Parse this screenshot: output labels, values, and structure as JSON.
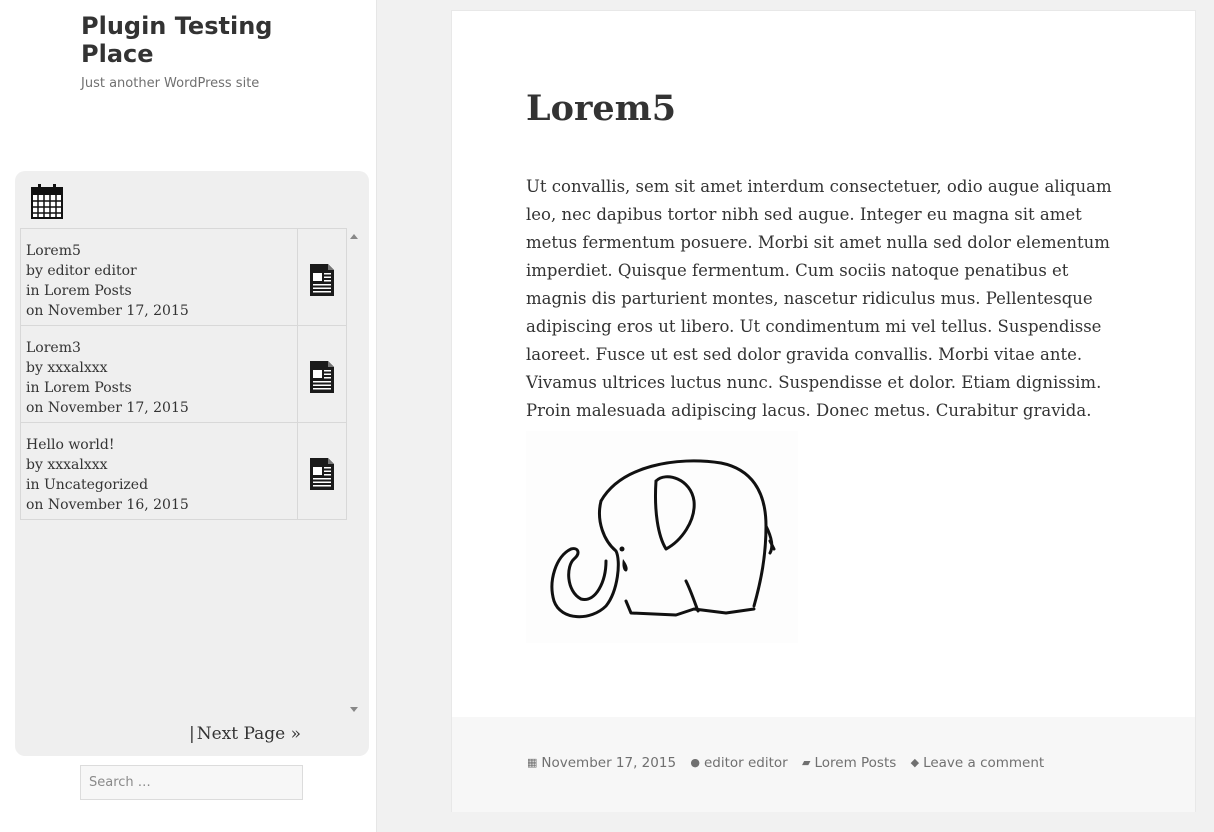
{
  "site": {
    "title": "Plugin Testing Place",
    "description": "Just another WordPress site"
  },
  "widget": {
    "calendar_icon": "calendar-icon",
    "posts": [
      {
        "title": "Lorem5",
        "author": "by editor editor",
        "category": "in Lorem Posts",
        "date": "on November 17, 2015",
        "icon": "document-icon"
      },
      {
        "title": "Lorem3",
        "author": "by xxxalxxx",
        "category": "in Lorem Posts",
        "date": "on November 17, 2015",
        "icon": "document-icon"
      },
      {
        "title": "Hello world!",
        "author": "by xxxalxxx",
        "category": "in Uncategorized",
        "date": "on November 16, 2015",
        "icon": "document-icon"
      }
    ],
    "pager": {
      "separator": "|",
      "next_label": "Next Page »"
    }
  },
  "search": {
    "placeholder": "Search …"
  },
  "article": {
    "title": "Lorem5",
    "body": "Ut convallis, sem sit amet interdum consectetuer, odio augue aliquam leo, nec dapibus tortor nibh sed augue. Integer eu magna sit amet metus fermentum posuere. Morbi sit amet nulla sed dolor elementum imperdiet. Quisque fermentum. Cum sociis natoque penatibus et magnis dis parturient montes, nascetur ridiculus mus. Pellentesque adipiscing eros ut libero. Ut condimentum mi vel tellus. Suspendisse laoreet. Fusce ut est sed dolor gravida convallis. Morbi vitae ante. Vivamus ultrices luctus nunc. Suspendisse et dolor. Etiam dignissim. Proin malesuada adipiscing lacus. Donec metus. Curabitur gravida.",
    "image": "elephant-drawing",
    "meta": {
      "date": "November 17, 2015",
      "author": "editor editor",
      "category": "Lorem Posts",
      "comments": "Leave a comment"
    }
  }
}
